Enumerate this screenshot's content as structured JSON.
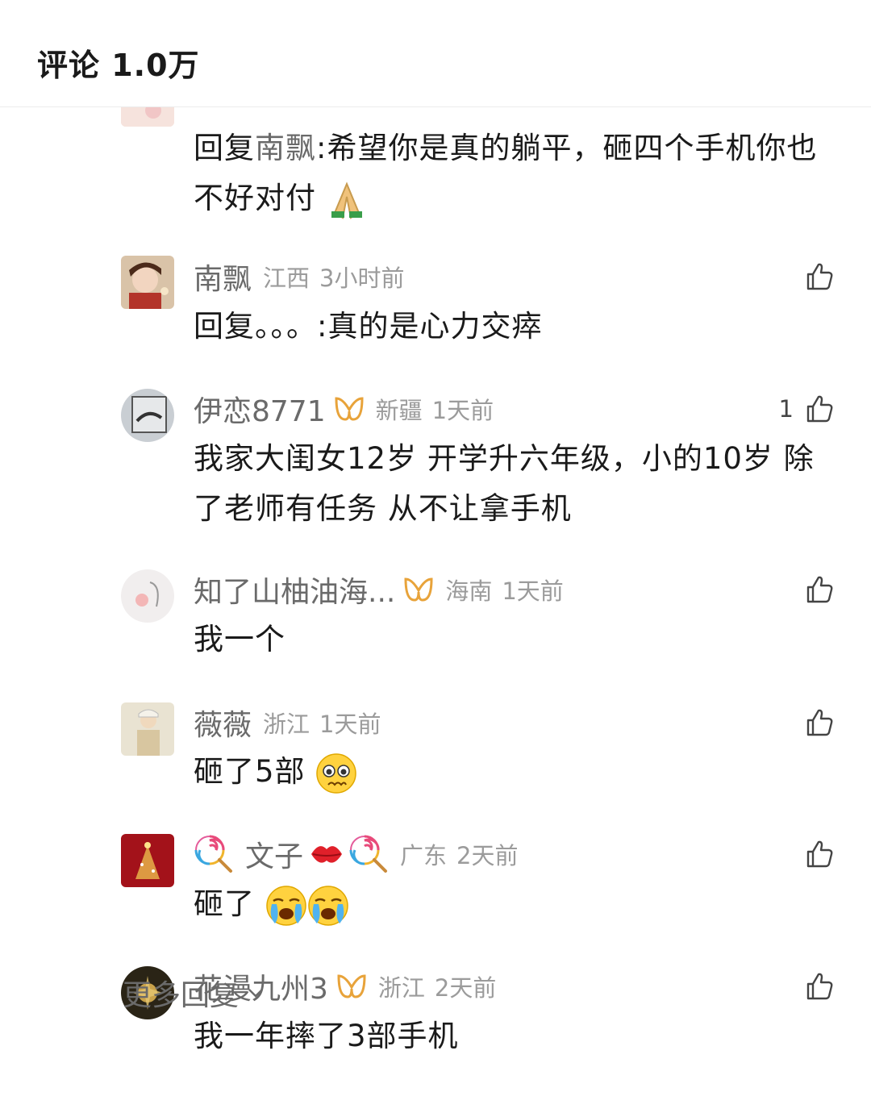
{
  "header": {
    "title": "评论 1.0万"
  },
  "comments": [
    {
      "reply_prefix": "回复",
      "reply_to": "南飘",
      "text": ":希望你是真的躺平，砸四个手机你也不好对付",
      "emoji": "folded-hands"
    },
    {
      "user": "南飘",
      "location": "江西",
      "time": "3小时前",
      "text": "回复。。。:真的是心力交瘁",
      "likes": ""
    },
    {
      "user": "伊恋8771",
      "location": "新疆",
      "time": "1天前",
      "text": "我家大闺女12岁 开学升六年级，小的10岁 除了老师有任务 从不让拿手机",
      "likes": "1",
      "badge": true
    },
    {
      "user": "知了山柚油海...",
      "location": "海南",
      "time": "1天前",
      "text": "我一个",
      "likes": "",
      "badge": true
    },
    {
      "user": "薇薇",
      "location": "浙江",
      "time": "1天前",
      "text": "砸了5部",
      "emoji": "pleading-face",
      "likes": ""
    },
    {
      "user": "文子",
      "location": "广东",
      "time": "2天前",
      "text": "砸了",
      "emoji": "loudly-crying-face",
      "likes": "",
      "name_emojis": [
        "lollipop",
        "kiss-mark",
        "lollipop"
      ]
    },
    {
      "user": "花漫九州3",
      "location": "浙江",
      "time": "2天前",
      "text": "我一年摔了3部手机",
      "likes": "",
      "badge": true
    }
  ],
  "more_replies": {
    "label": "更多回复"
  },
  "colors": {
    "username": "#6a6a6a",
    "meta": "#9b9b9b",
    "badge": "#e8a33a",
    "text": "#1a1a1a"
  }
}
